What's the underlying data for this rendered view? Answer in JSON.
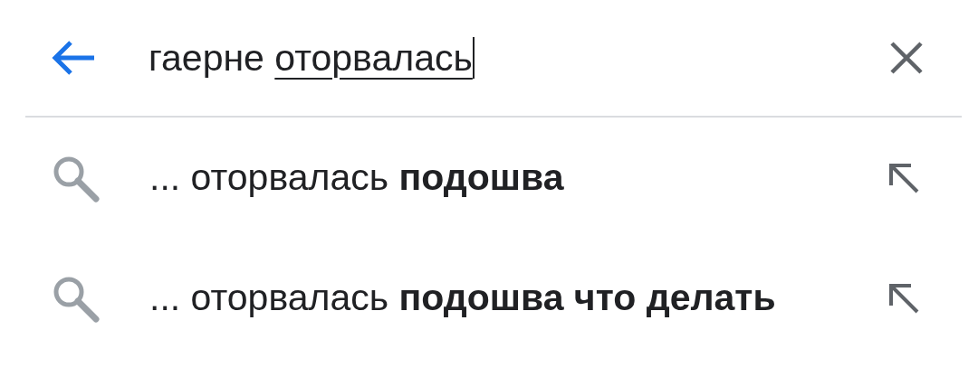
{
  "search": {
    "text": "гаерне ",
    "composing": "оторвалась"
  },
  "suggestions": [
    {
      "text": "... оторвалась **подошва**"
    },
    {
      "text": "... оторвалась **подошва что делать**"
    }
  ]
}
